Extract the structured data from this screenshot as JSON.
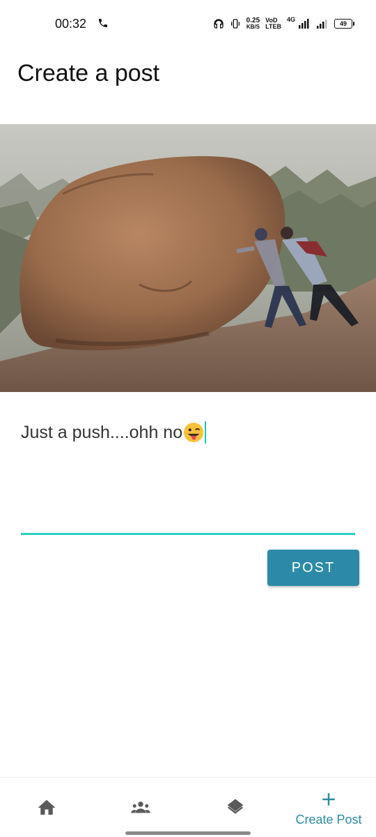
{
  "status_bar": {
    "time": "00:32",
    "call_icon": "phone-icon",
    "net_speed_value": "0.25",
    "net_speed_unit": "KB/S",
    "volte_top": "VoD",
    "volte_bottom": "LTEB",
    "network": "4G",
    "battery": "49"
  },
  "header": {
    "title": "Create a post"
  },
  "post": {
    "photo": "photo of two people pushing a large boulder on a hill",
    "text": "Just a push....ohh no",
    "emoji": "winking-tongue-emoji",
    "submit_label": "POST"
  },
  "bottom_nav": {
    "items": [
      {
        "icon": "home-icon",
        "label": ""
      },
      {
        "icon": "groups-icon",
        "label": ""
      },
      {
        "icon": "layers-icon",
        "label": ""
      },
      {
        "icon": "plus-icon",
        "label": "Create Post"
      }
    ]
  },
  "colors": {
    "accent": "#2c8aa8",
    "cursor": "#18c9b9",
    "underline": "#29cfc2",
    "nav_icon": "#5a5a5a"
  }
}
